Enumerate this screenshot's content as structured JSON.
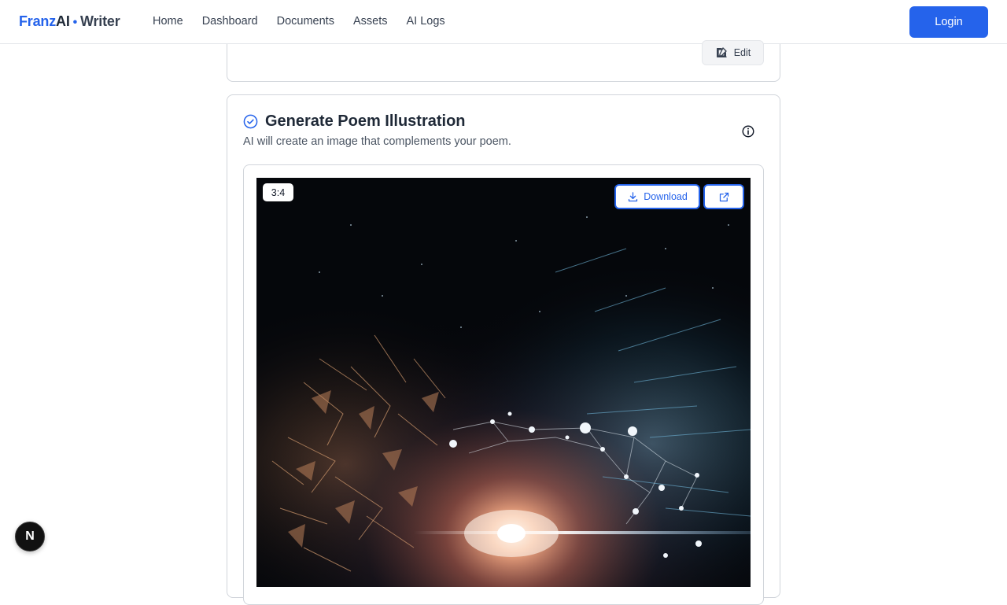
{
  "header": {
    "brand": {
      "part1": "Franz",
      "part2": "AI",
      "separator": "•",
      "part3": "Writer"
    },
    "nav": [
      "Home",
      "Dashboard",
      "Documents",
      "Assets",
      "AI Logs"
    ],
    "login_label": "Login"
  },
  "previous_card": {
    "edit_label": "Edit"
  },
  "illustration_card": {
    "title": "Generate Poem Illustration",
    "subtitle": "AI will create an image that complements your poem.",
    "status_icon": "check-circle-icon",
    "info_icon": "info-icon",
    "image": {
      "aspect_ratio": "3:4",
      "download_label": "Download",
      "download_icon": "download-icon",
      "open_icon": "external-link-icon"
    }
  },
  "floating_badge": {
    "letter": "N"
  },
  "colors": {
    "accent": "#2563eb",
    "text": "#1f2937",
    "muted": "#4b5563",
    "border": "#d1d5db"
  }
}
